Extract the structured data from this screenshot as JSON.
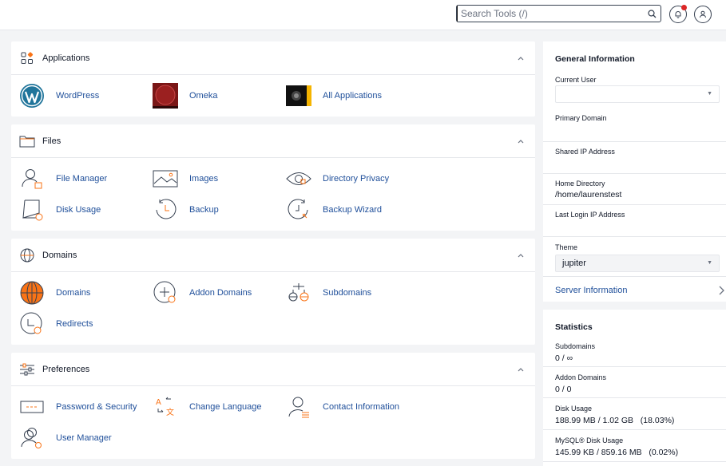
{
  "topbar": {
    "search_placeholder": "Search Tools (/)"
  },
  "colors": {
    "link": "#1f4f9a",
    "accent": "#f97316",
    "danger": "#dc2626"
  },
  "sections": {
    "applications": {
      "title": "Applications",
      "items": [
        {
          "label": "WordPress",
          "icon": "wordpress-icon"
        },
        {
          "label": "Omeka",
          "icon": "omeka-icon"
        },
        {
          "label": "All Applications",
          "icon": "all-applications-icon"
        }
      ]
    },
    "files": {
      "title": "Files",
      "items": [
        {
          "label": "File Manager",
          "icon": "file-manager-icon"
        },
        {
          "label": "Images",
          "icon": "images-icon"
        },
        {
          "label": "Directory Privacy",
          "icon": "eye-icon"
        },
        {
          "label": "Disk Usage",
          "icon": "disk-usage-icon"
        },
        {
          "label": "Backup",
          "icon": "backup-icon"
        },
        {
          "label": "Backup Wizard",
          "icon": "backup-wizard-icon"
        }
      ]
    },
    "domains": {
      "title": "Domains",
      "items": [
        {
          "label": "Domains",
          "icon": "globe-icon"
        },
        {
          "label": "Addon Domains",
          "icon": "addon-domains-icon"
        },
        {
          "label": "Subdomains",
          "icon": "subdomains-icon"
        },
        {
          "label": "Redirects",
          "icon": "redirects-icon"
        }
      ]
    },
    "preferences": {
      "title": "Preferences",
      "items": [
        {
          "label": "Password & Security",
          "icon": "password-icon"
        },
        {
          "label": "Change Language",
          "icon": "language-icon"
        },
        {
          "label": "Contact Information",
          "icon": "contact-icon"
        },
        {
          "label": "User Manager",
          "icon": "user-manager-icon"
        }
      ]
    }
  },
  "general": {
    "title": "General Information",
    "current_user_label": "Current User",
    "current_user_value": "",
    "primary_domain_label": "Primary Domain",
    "primary_domain_value": "",
    "shared_ip_label": "Shared IP Address",
    "shared_ip_value": "",
    "home_dir_label": "Home Directory",
    "home_dir_value": "/home/laurenstest",
    "last_login_label": "Last Login IP Address",
    "last_login_value": "",
    "theme_label": "Theme",
    "theme_value": "jupiter",
    "server_info_label": "Server Information"
  },
  "statistics": {
    "title": "Statistics",
    "rows": [
      {
        "label": "Subdomains",
        "value": "0 / ∞"
      },
      {
        "label": "Addon Domains",
        "value": "0 / 0"
      },
      {
        "label": "Disk Usage",
        "value": "188.99 MB / 1.02 GB   (18.03%)"
      },
      {
        "label": "MySQL® Disk Usage",
        "value": "145.99 KB / 859.16 MB   (0.02%)"
      }
    ]
  }
}
